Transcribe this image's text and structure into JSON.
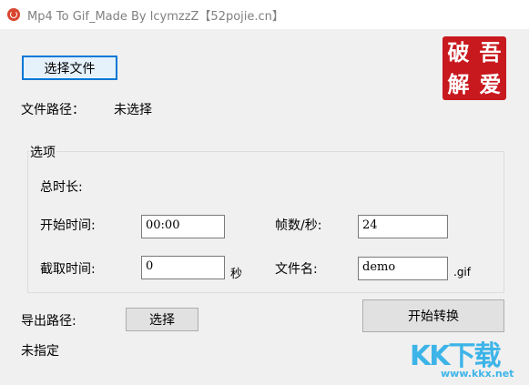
{
  "window": {
    "title": "Mp4 To Gif_Made By lcymzzZ【52pojie.cn】",
    "icon": "app-icon"
  },
  "select_file_button": "选择文件",
  "file_path": {
    "label": "文件路径：",
    "value": "未选择"
  },
  "options": {
    "group_title": "选项",
    "total_duration_label": "总时长:",
    "start_time_label": "开始时间:",
    "start_time_value": "00:00",
    "fps_label": "帧数/秒:",
    "fps_value": "24",
    "clip_time_label": "截取时间:",
    "clip_time_value": "0",
    "seconds_unit": "秒",
    "filename_label": "文件名:",
    "filename_value": "demo",
    "filename_ext": ".gif"
  },
  "export": {
    "label": "导出路径:",
    "select_button": "选择",
    "status": "未指定"
  },
  "convert_button": "开始转换",
  "seal": {
    "chars": [
      "破",
      "吾",
      "解",
      "爱"
    ]
  },
  "watermark": {
    "text": "KK下载",
    "url": "www.kkx.net"
  },
  "colors": {
    "seal": "#c8191e",
    "focus": "#0078d7",
    "watermark": "#3db4e8"
  }
}
